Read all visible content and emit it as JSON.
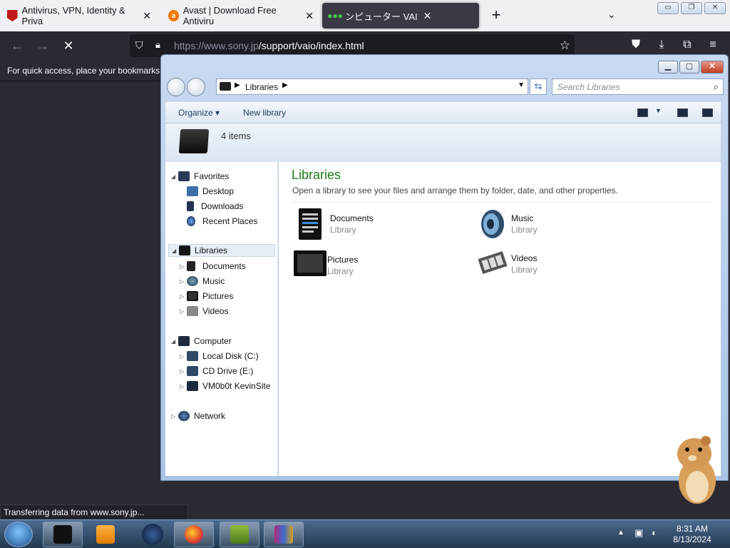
{
  "browser": {
    "tabs": [
      {
        "title": "Antivirus, VPN, Identity & Priva",
        "favicon": "mcafee-icon"
      },
      {
        "title": "Avast | Download Free Antiviru",
        "favicon": "avast-icon"
      },
      {
        "title": "ンピューター VAI",
        "favicon": "loading-icon"
      }
    ],
    "url_domain": "https://www.sony.jp",
    "url_path": "/support/vaio/index.html",
    "bookmarks_hint": "For quick access, place your bookmarks h",
    "status": "Transferring data from www.sony.jp..."
  },
  "explorer": {
    "breadcrumb": "Libraries",
    "search_placeholder": "Search Libraries",
    "toolbar": {
      "organize": "Organize ▾",
      "new_library": "New library"
    },
    "item_count": "4 items",
    "title": "Libraries",
    "subtitle": "Open a library to see your files and arrange them by folder, date, and other properties.",
    "nav": {
      "favorites": "Favorites",
      "desktop": "Desktop",
      "downloads": "Downloads",
      "recent": "Recent Places",
      "libraries": "Libraries",
      "documents": "Documents",
      "music": "Music",
      "pictures": "Pictures",
      "videos": "Videos",
      "computer": "Computer",
      "local_disk": "Local Disk (C:)",
      "cd_drive": "CD Drive (E:)",
      "vm": "VM0b0t KevinSite",
      "network": "Network"
    },
    "libraries": [
      {
        "name": "Documents",
        "kind": "Library"
      },
      {
        "name": "Music",
        "kind": "Library"
      },
      {
        "name": "Pictures",
        "kind": "Library"
      },
      {
        "name": "Videos",
        "kind": "Library"
      }
    ]
  },
  "taskbar": {
    "time": "8:31 AM",
    "date": "8/13/2024"
  },
  "colors": {
    "accent_green": "#1e7b1e",
    "firefox_dark": "#2b2a33"
  }
}
